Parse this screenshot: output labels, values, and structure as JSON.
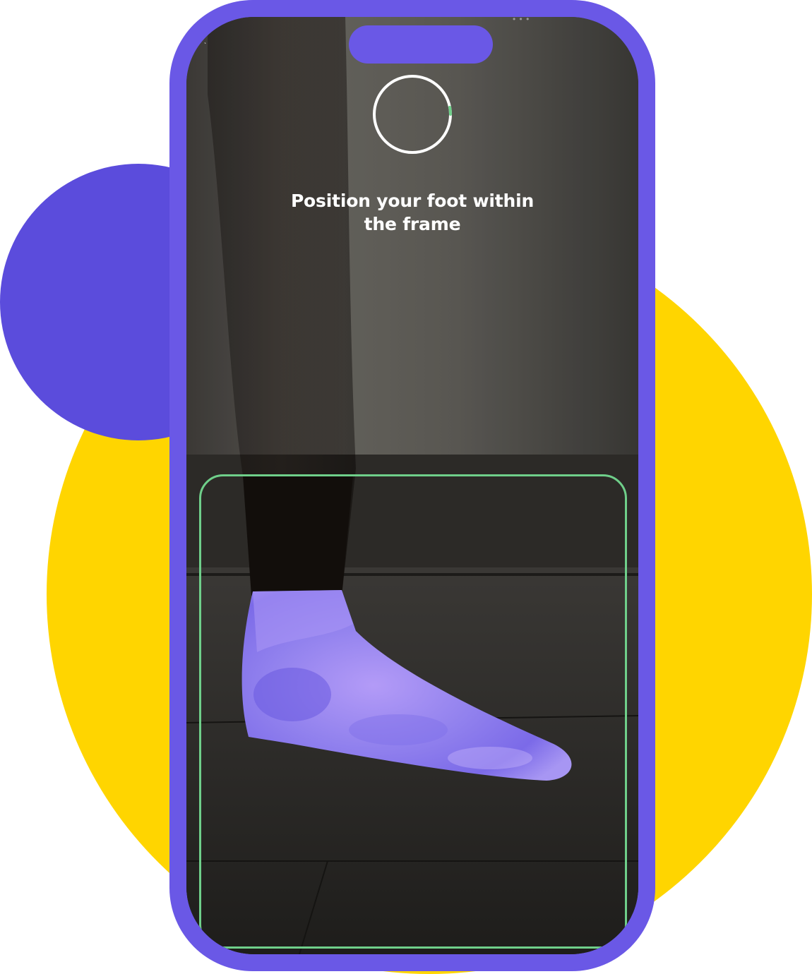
{
  "instruction": {
    "line1": "Position your foot within",
    "line2": "the frame"
  },
  "progress": {
    "fraction": 0.03
  },
  "colors": {
    "phone_frame": "#6a58e6",
    "bg_yellow": "#ffd500",
    "bg_purple": "#5b4cdc",
    "scan_frame": "#6fcf8a",
    "progress_fill": "#6fcf8a",
    "progress_track": "#ffffff",
    "foot_mesh": "#9d8cf2"
  },
  "icons": {
    "status_left": "back-tick-icon",
    "status_right": "signal-dots-icon"
  }
}
